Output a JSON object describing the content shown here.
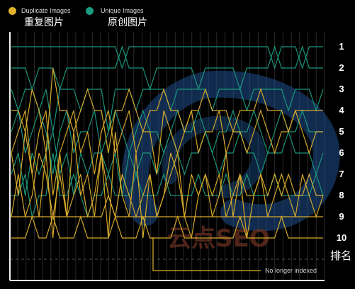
{
  "chart_data": {
    "type": "line",
    "legend": [
      {
        "name": "Duplicate Images",
        "zh": "重复图片",
        "color": "#e0b12c"
      },
      {
        "name": "Unique Images",
        "zh": "原创图片",
        "color": "#1a9c80"
      }
    ],
    "y_ticks": [
      "1",
      "2",
      "3",
      "4",
      "5",
      "6",
      "7",
      "8",
      "9",
      "10"
    ],
    "y_title": "排名",
    "y_range": [
      1,
      10
    ],
    "annotation": "No longer indexed",
    "watermark": "云点SEO",
    "grid": "vertical",
    "series": [
      {
        "group": "Unique Images",
        "values": [
          1,
          1,
          1,
          1,
          1,
          1,
          1,
          1,
          1,
          1,
          1,
          1,
          1,
          1,
          1,
          1,
          2,
          1,
          1,
          1,
          1,
          1,
          1,
          1,
          1,
          1,
          1,
          1,
          1,
          1,
          1,
          1,
          1,
          1,
          1,
          1,
          1,
          1,
          2,
          1,
          1,
          1,
          2,
          1,
          1,
          1
        ]
      },
      {
        "group": "Unique Images",
        "values": [
          2,
          2,
          2,
          3,
          2,
          2,
          2,
          3,
          2,
          2,
          2,
          2,
          2,
          2,
          2,
          2,
          1,
          2,
          2,
          2,
          3,
          2,
          2,
          2,
          2,
          2,
          2,
          3,
          2,
          2,
          2,
          2,
          2,
          3,
          2,
          2,
          2,
          2,
          1,
          2,
          2,
          2,
          1,
          2,
          2,
          2
        ]
      },
      {
        "group": "Unique Images",
        "values": [
          3,
          4,
          3,
          3,
          4,
          3,
          5,
          3,
          3,
          3,
          4,
          3,
          3,
          3,
          5,
          3,
          3,
          3,
          4,
          3,
          3,
          3,
          3,
          4,
          3,
          3,
          3,
          3,
          3,
          4,
          3,
          3,
          3,
          3,
          4,
          3,
          3,
          3,
          3,
          3,
          4,
          3,
          3,
          3,
          4,
          3
        ]
      },
      {
        "group": "Unique Images",
        "values": [
          5,
          4,
          6,
          5,
          4,
          5,
          7,
          5,
          4,
          6,
          5,
          5,
          4,
          6,
          5,
          4,
          5,
          6,
          5,
          4,
          5,
          5,
          6,
          5,
          4,
          5,
          5,
          4,
          5,
          6,
          5,
          5,
          4,
          5,
          5,
          4,
          5,
          6,
          5,
          4,
          5,
          5,
          4,
          5,
          5,
          5
        ]
      },
      {
        "group": "Unique Images",
        "values": [
          7,
          6,
          8,
          6,
          7,
          6,
          5,
          7,
          6,
          8,
          6,
          7,
          6,
          6,
          7,
          6,
          8,
          6,
          7,
          6,
          6,
          7,
          6,
          5,
          6,
          7,
          6,
          6,
          5,
          6,
          7,
          6,
          6,
          5,
          6,
          6,
          7,
          6,
          6,
          6,
          5,
          6,
          6,
          6,
          7,
          6
        ]
      },
      {
        "group": "Unique Images",
        "values": [
          8,
          8,
          7,
          9,
          8,
          8,
          6,
          8,
          8,
          7,
          8,
          9,
          8,
          8,
          7,
          8,
          8,
          8,
          7,
          8,
          8,
          8,
          7,
          8,
          8,
          8,
          8,
          7,
          8,
          8,
          8,
          7,
          8,
          8,
          7,
          8,
          8,
          8,
          7,
          8,
          8,
          8,
          8,
          8,
          7,
          8
        ]
      },
      {
        "group": "Duplicate Images",
        "values": [
          4,
          4,
          5,
          3,
          4,
          6,
          2,
          4,
          4,
          5,
          4,
          3,
          4,
          4,
          6,
          4,
          4,
          3,
          4,
          5,
          4,
          4,
          3,
          4,
          4,
          5,
          4,
          4,
          3,
          4,
          4,
          4,
          5,
          4,
          4,
          4,
          3,
          4,
          4,
          4,
          5,
          4,
          4,
          4,
          4,
          4
        ]
      },
      {
        "group": "Duplicate Images",
        "values": [
          6,
          5,
          4,
          7,
          5,
          4,
          8,
          6,
          5,
          4,
          6,
          5,
          7,
          5,
          4,
          6,
          5,
          4,
          6,
          5,
          5,
          7,
          4,
          5,
          6,
          5,
          4,
          6,
          5,
          5,
          4,
          6,
          5,
          5,
          6,
          5,
          4,
          5,
          6,
          5,
          5,
          4,
          5,
          6,
          5,
          5
        ]
      },
      {
        "group": "Duplicate Images",
        "values": [
          9,
          7,
          9,
          8,
          6,
          7,
          9,
          7,
          9,
          8,
          7,
          9,
          8,
          6,
          8,
          9,
          7,
          8,
          9,
          8,
          7,
          9,
          8,
          7,
          6,
          9,
          7,
          8,
          7,
          8,
          7,
          9,
          8,
          7,
          8,
          8,
          7,
          8,
          7,
          8,
          7,
          8,
          8,
          7,
          8,
          8
        ]
      },
      {
        "group": "Duplicate Images",
        "values": [
          10,
          10,
          10,
          9,
          10,
          10,
          9,
          10,
          10,
          10,
          9,
          10,
          10,
          10,
          10,
          9,
          10,
          10,
          10,
          9,
          10,
          10,
          10,
          10,
          9,
          10,
          10,
          10,
          10,
          10,
          10,
          10,
          10,
          9,
          10,
          10,
          10,
          10,
          10,
          9,
          10,
          10,
          10,
          10,
          10,
          10
        ]
      },
      {
        "group": "Duplicate Images",
        "values": [
          9,
          9,
          9,
          9,
          9,
          9,
          9,
          9,
          9,
          9,
          9,
          9,
          9,
          9,
          8,
          9,
          9,
          9,
          9,
          9,
          9,
          9,
          9,
          9,
          9,
          9,
          9,
          9,
          9,
          9,
          9,
          9,
          9,
          9,
          9,
          9,
          9,
          9,
          9,
          9,
          9,
          9,
          9,
          9,
          9,
          9
        ]
      },
      {
        "group": "Duplicate Images",
        "values": [
          6,
          8,
          5,
          7,
          9,
          6,
          10,
          6,
          9,
          5,
          8,
          7,
          9,
          6,
          10,
          5,
          8,
          9,
          6,
          10,
          7,
          9,
          8,
          6,
          7,
          9,
          10,
          8,
          7,
          9,
          8,
          6,
          9,
          7,
          10,
          8,
          7,
          9,
          8,
          7,
          8,
          9,
          7,
          8,
          9,
          8
        ]
      }
    ]
  }
}
